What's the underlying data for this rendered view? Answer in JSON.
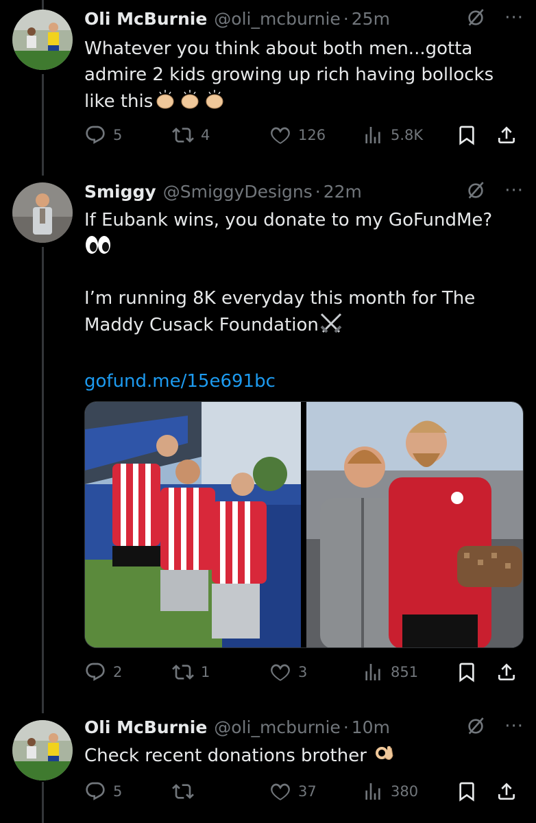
{
  "tweets": [
    {
      "name": "Oli McBurnie",
      "handle": "@oli_mcburnie",
      "time": "25m",
      "text_lines": [
        "Whatever you think about both men...gotta",
        "admire 2 kids growing up rich having bollocks",
        "like this"
      ],
      "emojis": [
        "clapping-hands",
        "clapping-hands",
        "clapping-hands"
      ],
      "actions": {
        "replies": "5",
        "retweets": "4",
        "likes": "126",
        "views": "5.8K"
      }
    },
    {
      "name": "Smiggy",
      "handle": "@SmiggyDesigns",
      "time": "22m",
      "text_lines": [
        "If Eubank wins, you donate to my GoFundMe?"
      ],
      "emoji_line": "eyes",
      "text_lines_2": [
        "I’m running 8K everyday this month for The",
        "Maddy Cusack Foundation"
      ],
      "crossed_swords": "crossed-swords",
      "link": "gofund.me/15e691bc",
      "photos": [
        "photo-football-fans-stadium",
        "photo-footballer-with-fan"
      ],
      "actions": {
        "replies": "2",
        "retweets": "1",
        "likes": "3",
        "views": "851"
      }
    },
    {
      "name": "Oli McBurnie",
      "handle": "@oli_mcburnie",
      "time": "10m",
      "text_lines": [
        "Check recent donations brother"
      ],
      "emojis": [
        "ok-hand"
      ],
      "actions": {
        "replies": "5",
        "retweets": "",
        "likes": "37",
        "views": "380"
      }
    }
  ],
  "dot": "·",
  "more": "···",
  "colors": {
    "background": "#000000",
    "text": "#e7e9ea",
    "muted": "#71767b",
    "link": "#1d9bf0",
    "line": "#333639"
  },
  "icons": [
    "reply-icon",
    "retweet-icon",
    "like-icon",
    "views-icon",
    "bookmark-icon",
    "share-icon",
    "mute-icon",
    "more-icon"
  ]
}
